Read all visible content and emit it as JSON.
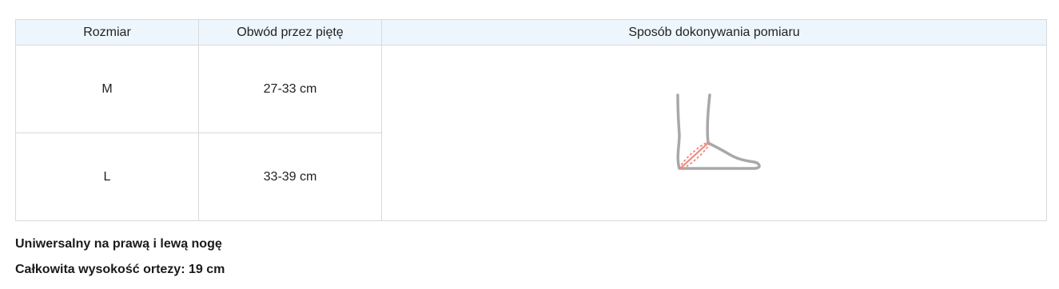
{
  "table": {
    "headers": {
      "size": "Rozmiar",
      "circumference": "Obwód przez piętę",
      "method": "Sposób dokonywania pomiaru"
    },
    "rows": [
      {
        "size": "M",
        "circumference": "27-33 cm"
      },
      {
        "size": "L",
        "circumference": "33-39 cm"
      }
    ],
    "illustration": {
      "icon": "foot-heel-measurement-icon",
      "outline_color": "#a8a8a8",
      "measure_color": "#ee8a7e"
    }
  },
  "notes": {
    "line1": "Uniwersalny na prawą i lewą nogę",
    "line2": "Całkowita wysokość ortezy: 19 cm"
  }
}
